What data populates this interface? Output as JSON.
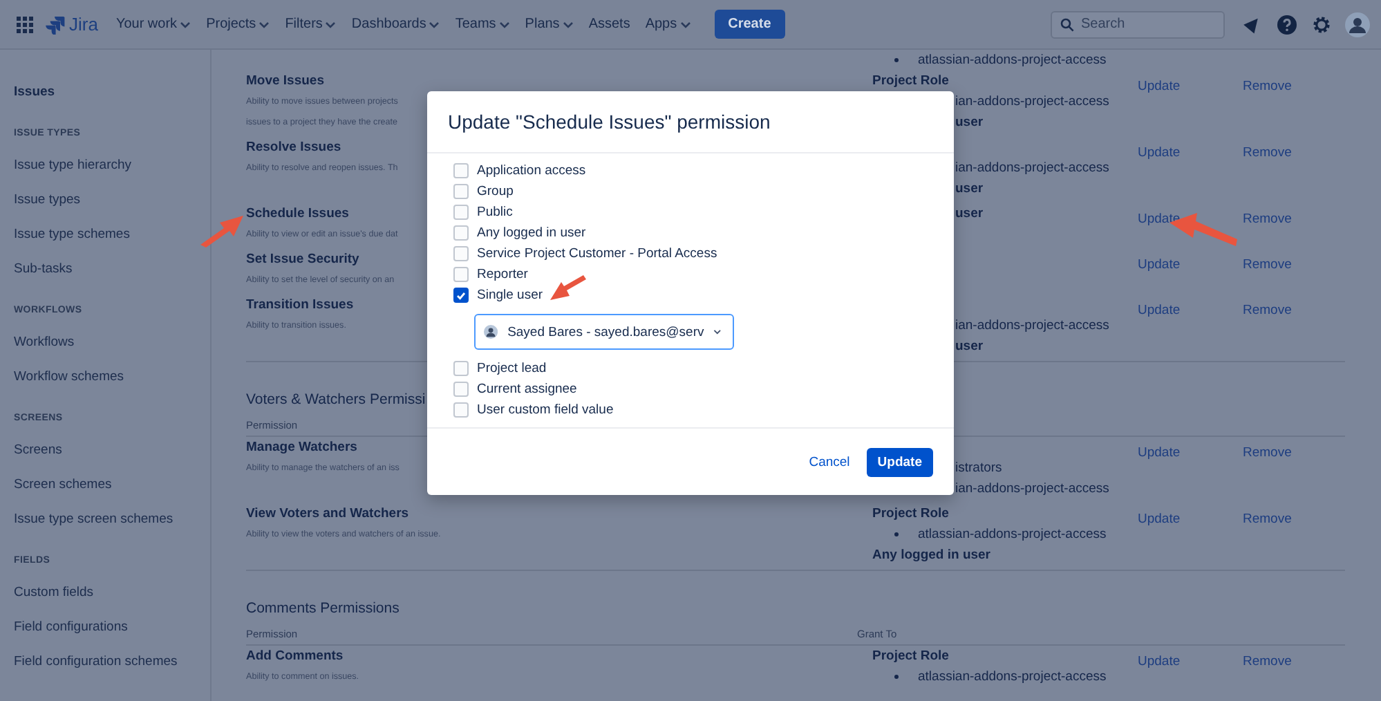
{
  "nav": {
    "logo": "Jira",
    "items": [
      {
        "label": "Your work",
        "dropdown": true
      },
      {
        "label": "Projects",
        "dropdown": true
      },
      {
        "label": "Filters",
        "dropdown": true
      },
      {
        "label": "Dashboards",
        "dropdown": true
      },
      {
        "label": "Teams",
        "dropdown": true
      },
      {
        "label": "Plans",
        "dropdown": true
      },
      {
        "label": "Assets",
        "dropdown": false
      },
      {
        "label": "Apps",
        "dropdown": true
      }
    ],
    "create": "Create",
    "search": {
      "placeholder": "Search"
    }
  },
  "sidebar": {
    "sections": [
      {
        "items": [
          "Issues"
        ]
      },
      {
        "heading": "ISSUE TYPES",
        "items": [
          "Issue type hierarchy",
          "Issue types",
          "Issue type schemes",
          "Sub-tasks"
        ]
      },
      {
        "heading": "WORKFLOWS",
        "items": [
          "Workflows",
          "Workflow schemes"
        ]
      },
      {
        "heading": "SCREENS",
        "items": [
          "Screens",
          "Screen schemes",
          "Issue type screen schemes"
        ]
      },
      {
        "heading": "FIELDS",
        "items": [
          "Custom fields",
          "Field configurations",
          "Field configuration schemes"
        ]
      }
    ]
  },
  "main": {
    "blocks": [
      {
        "kind": "fragment",
        "grant": [
          {
            "kind": "bullet",
            "text": "atlassian-addons-project-access"
          }
        ]
      },
      {
        "kind": "permission",
        "name": "Move Issues",
        "description": [
          "Ability to move issues between projects",
          "issues to a project they have the create"
        ],
        "grant": [
          {
            "kind": "heading",
            "text": "Project Role"
          },
          {
            "kind": "clipped",
            "text": "ian-addons-project-access"
          },
          {
            "kind": "clipped_heading",
            "text": "user"
          }
        ],
        "update": "Update",
        "remove": "Remove"
      },
      {
        "kind": "permission",
        "name": "Resolve Issues",
        "description": [
          "Ability to resolve and reopen issues. Th"
        ],
        "grant": [
          {
            "kind": "clipped",
            "text": "ian-addons-project-access"
          },
          {
            "kind": "clipped_heading",
            "text": "user"
          }
        ],
        "update": "Update",
        "remove": "Remove"
      },
      {
        "kind": "permission",
        "name": "Schedule Issues",
        "description": [
          "Ability to view or edit an issue's due dat"
        ],
        "grant": [
          {
            "kind": "clipped_heading",
            "text": "user"
          }
        ],
        "update": "Update",
        "remove": "Remove"
      },
      {
        "kind": "permission",
        "name": "Set Issue Security",
        "description": [
          "Ability to set the level of security on an"
        ],
        "update": "Update",
        "remove": "Remove"
      },
      {
        "kind": "permission",
        "name": "Transition Issues",
        "description": [
          "Ability to transition issues."
        ],
        "grant": [
          {
            "kind": "clipped",
            "text": "ian-addons-project-access"
          },
          {
            "kind": "clipped_heading",
            "text": "user"
          }
        ],
        "update": "Update",
        "remove": "Remove"
      },
      {
        "kind": "section",
        "title": "Voters & Watchers Permissi",
        "columns": [
          "Permission"
        ]
      },
      {
        "kind": "permission",
        "name": "Manage Watchers",
        "description": [
          "Ability to manage the watchers of an iss"
        ],
        "grant": [
          {
            "kind": "clipped",
            "text": "istrators"
          },
          {
            "kind": "clipped",
            "text": "ian-addons-project-access"
          }
        ],
        "update": "Update",
        "remove": "Remove"
      },
      {
        "kind": "permission",
        "name": "View Voters and Watchers",
        "description": [
          "Ability to view the voters and watchers of an issue."
        ],
        "grant": [
          {
            "kind": "heading",
            "text": "Project Role"
          },
          {
            "kind": "bullet",
            "text": "atlassian-addons-project-access"
          },
          {
            "kind": "heading",
            "text": "Any logged in user"
          }
        ],
        "update": "Update",
        "remove": "Remove"
      },
      {
        "kind": "section",
        "title": "Comments Permissions",
        "columns": [
          "Permission",
          "Grant To"
        ]
      },
      {
        "kind": "permission",
        "name": "Add Comments",
        "description": [
          "Ability to comment on issues."
        ],
        "grant": [
          {
            "kind": "heading",
            "text": "Project Role"
          },
          {
            "kind": "bullet",
            "text": "atlassian-addons-project-access"
          }
        ],
        "update": "Update",
        "remove": "Remove"
      }
    ]
  },
  "modal": {
    "title": "Update \"Schedule Issues\" permission",
    "options": [
      {
        "label": "Application access",
        "checked": false
      },
      {
        "label": "Group",
        "checked": false
      },
      {
        "label": "Public",
        "checked": false
      },
      {
        "label": "Any logged in user",
        "checked": false
      },
      {
        "label": "Service Project Customer - Portal Access",
        "checked": false
      },
      {
        "label": "Reporter",
        "checked": false
      },
      {
        "label": "Single user",
        "checked": true,
        "user_field": {
          "value": "Sayed Bares - sayed.bares@serv"
        }
      },
      {
        "label": "Project lead",
        "checked": false
      },
      {
        "label": "Current assignee",
        "checked": false
      },
      {
        "label": "User custom field value",
        "checked": false
      }
    ],
    "cancel": "Cancel",
    "submit": "Update"
  }
}
